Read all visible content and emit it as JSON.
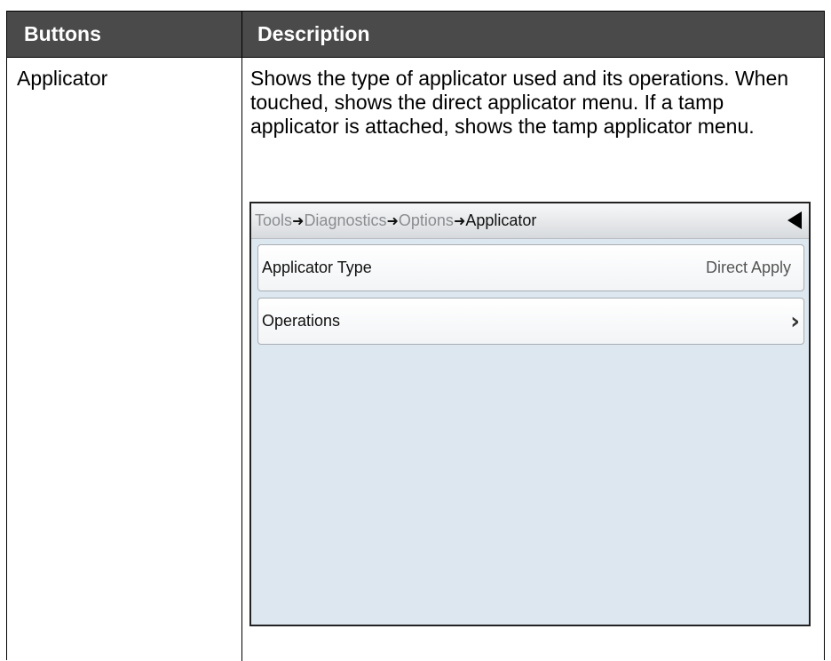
{
  "table": {
    "headers": [
      "Buttons",
      "Description"
    ],
    "rows": [
      {
        "button": "Applicator",
        "description": "Shows the type of applicator used and its operations. When touched, shows the direct applicator menu. If a tamp applicator is attached, shows the tamp applicator menu."
      }
    ]
  },
  "screen": {
    "breadcrumb": {
      "items": [
        "Tools",
        "Diagnostics",
        "Options",
        "Applicator"
      ],
      "separator": "➜"
    },
    "back_icon": "back-triangle-icon",
    "rows": [
      {
        "label": "Applicator Type",
        "value": "Direct Apply"
      },
      {
        "label": "Operations",
        "chevron": "›"
      }
    ]
  }
}
